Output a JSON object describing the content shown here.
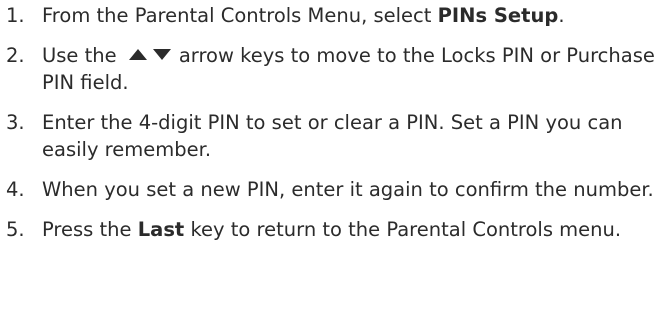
{
  "steps": [
    {
      "number": "1.",
      "text_before": "From the Parental Controls Menu, select ",
      "bold": "PINs Setup",
      "text_after": "."
    },
    {
      "number": "2.",
      "text_before": "Use the",
      "icons": [
        "arrow-up-icon",
        "arrow-down-icon"
      ],
      "text_after": "arrow keys to move to the Locks PIN or Purchase PIN field."
    },
    {
      "number": "3.",
      "text": "Enter the 4-digit PIN to set or clear a PIN. Set a PIN you can easily remember."
    },
    {
      "number": "4.",
      "text": "When you set a new PIN, enter it again to confirm the number."
    },
    {
      "number": "5.",
      "text_before": "Press the ",
      "bold": "Last",
      "text_after": " key to return to the Parental Controls menu."
    }
  ]
}
